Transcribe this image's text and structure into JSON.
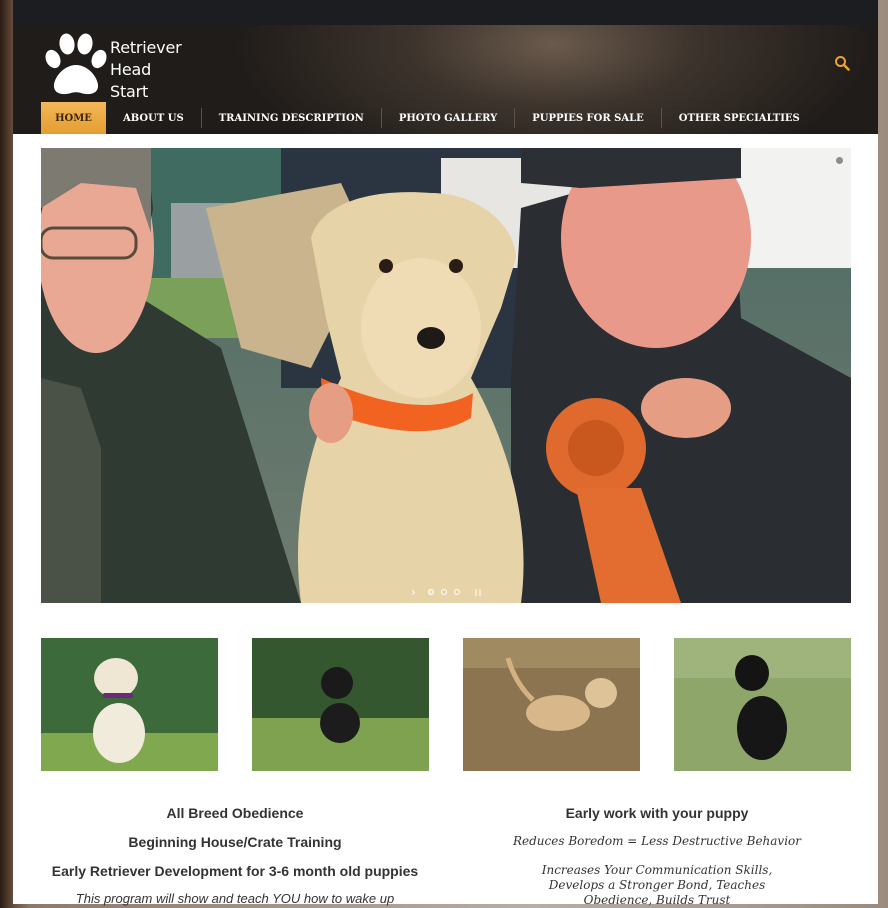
{
  "logo": {
    "line1": "Retriever",
    "line2": "Head",
    "line3": "Start"
  },
  "nav": {
    "items": [
      {
        "label": "HOME"
      },
      {
        "label": "ABOUT US"
      },
      {
        "label": "TRAINING DESCRIPTION"
      },
      {
        "label": "PHOTO GALLERY"
      },
      {
        "label": "PUPPIES FOR SALE"
      },
      {
        "label": "OTHER SPECIALTIES"
      }
    ]
  },
  "slider": {
    "current_slide": 1,
    "slide_count": 3
  },
  "left_column": {
    "heading1": "All Breed Obedience",
    "heading2": "Beginning House/Crate Training",
    "heading3": "Early Retriever Development for 3-6 month old puppies",
    "body": "This program will show and teach YOU how to wake up"
  },
  "right_column": {
    "heading": "Early work with your puppy",
    "line1": "Reduces Boredom = Less Destructive Behavior",
    "line2": "Increases Your Communication Skills, Develops a Stronger Bond, Teaches Obedience, Builds Trust"
  },
  "colors": {
    "accent": "#e8a33a",
    "header_bg": "#2a2520",
    "topbar": "#1b1d20"
  },
  "icons": {
    "search": "search-icon",
    "logo": "paw-icon"
  }
}
